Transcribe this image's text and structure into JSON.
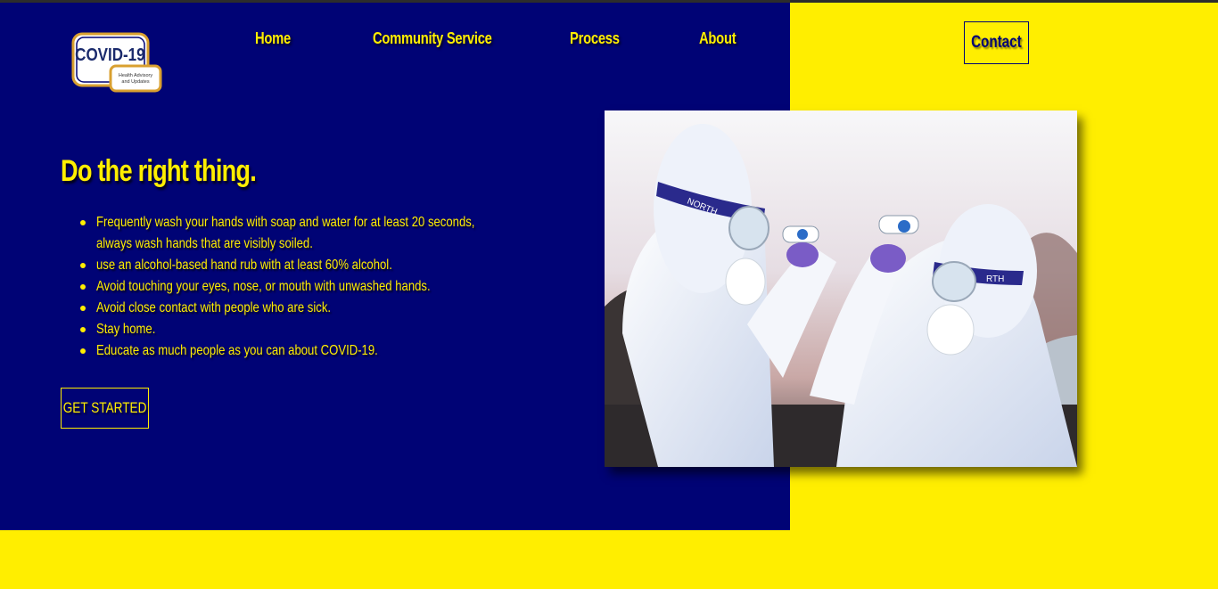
{
  "logo": {
    "title": "COVID-19",
    "subtitle_line1": "Health Advisory",
    "subtitle_line2": "and Updates"
  },
  "nav": {
    "items": [
      {
        "label": "Home"
      },
      {
        "label": "Community Service"
      },
      {
        "label": "Process"
      },
      {
        "label": "About"
      }
    ],
    "contact_label": "Contact"
  },
  "hero": {
    "headline": "Do the right thing.",
    "tips": [
      "Frequently wash your hands with soap and water for at least 20 seconds, always wash hands that are visibly soiled.",
      "use an alcohol-based hand rub with at least 60% alcohol.",
      "Avoid touching your eyes, nose, or mouth with unwashed hands.",
      "Avoid close contact with people who are sick.",
      "Stay home.",
      "Educate as much people as you can about COVID-19."
    ],
    "cta_label": "GET STARTED"
  },
  "photo": {
    "badge_text": "NORTH",
    "badge_text_2": "RTH"
  },
  "colors": {
    "primary_blue": "#000375",
    "accent_yellow": "#ffee00"
  }
}
